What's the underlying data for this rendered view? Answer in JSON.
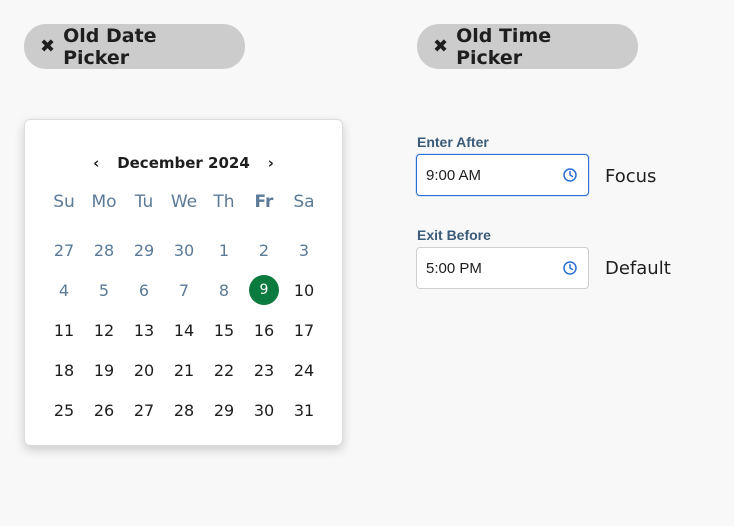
{
  "chips": {
    "date_label": "Old Date Picker",
    "time_label": "Old Time Picker"
  },
  "calendar": {
    "prev_icon": "‹",
    "next_icon": "›",
    "month_label": "December 2024",
    "weekdays": [
      "Su",
      "Mo",
      "Tu",
      "We",
      "Th",
      "Fr",
      "Sa"
    ],
    "selected_day": "9",
    "days": [
      {
        "d": "27",
        "type": "muted"
      },
      {
        "d": "28",
        "type": "muted"
      },
      {
        "d": "29",
        "type": "muted"
      },
      {
        "d": "30",
        "type": "muted"
      },
      {
        "d": "1",
        "type": "past"
      },
      {
        "d": "2",
        "type": "past"
      },
      {
        "d": "3",
        "type": "past"
      },
      {
        "d": "4",
        "type": "past"
      },
      {
        "d": "5",
        "type": "past"
      },
      {
        "d": "6",
        "type": "past"
      },
      {
        "d": "7",
        "type": "past"
      },
      {
        "d": "8",
        "type": "past"
      },
      {
        "d": "9",
        "type": "selected"
      },
      {
        "d": "10",
        "type": "normal"
      },
      {
        "d": "11",
        "type": "normal"
      },
      {
        "d": "12",
        "type": "normal"
      },
      {
        "d": "13",
        "type": "normal"
      },
      {
        "d": "14",
        "type": "normal"
      },
      {
        "d": "15",
        "type": "normal"
      },
      {
        "d": "16",
        "type": "normal"
      },
      {
        "d": "17",
        "type": "normal"
      },
      {
        "d": "18",
        "type": "normal"
      },
      {
        "d": "19",
        "type": "normal"
      },
      {
        "d": "20",
        "type": "normal"
      },
      {
        "d": "21",
        "type": "normal"
      },
      {
        "d": "22",
        "type": "normal"
      },
      {
        "d": "23",
        "type": "normal"
      },
      {
        "d": "24",
        "type": "normal"
      },
      {
        "d": "25",
        "type": "normal"
      },
      {
        "d": "26",
        "type": "normal"
      },
      {
        "d": "27",
        "type": "normal"
      },
      {
        "d": "28",
        "type": "normal"
      },
      {
        "d": "29",
        "type": "normal"
      },
      {
        "d": "30",
        "type": "normal"
      },
      {
        "d": "31",
        "type": "normal"
      }
    ]
  },
  "time": {
    "enter_after": {
      "label": "Enter After",
      "value": "9:00 AM",
      "state": "Focus"
    },
    "exit_before": {
      "label": "Exit Before",
      "value": "5:00 PM",
      "state": "Default"
    }
  },
  "colors": {
    "selected_day": "#0b7a3e",
    "focus_border": "#2a6fd6",
    "clock_icon": "#2a6fd6"
  },
  "icons": [
    "close-icon",
    "chevron-left-icon",
    "chevron-right-icon",
    "clock-icon"
  ]
}
